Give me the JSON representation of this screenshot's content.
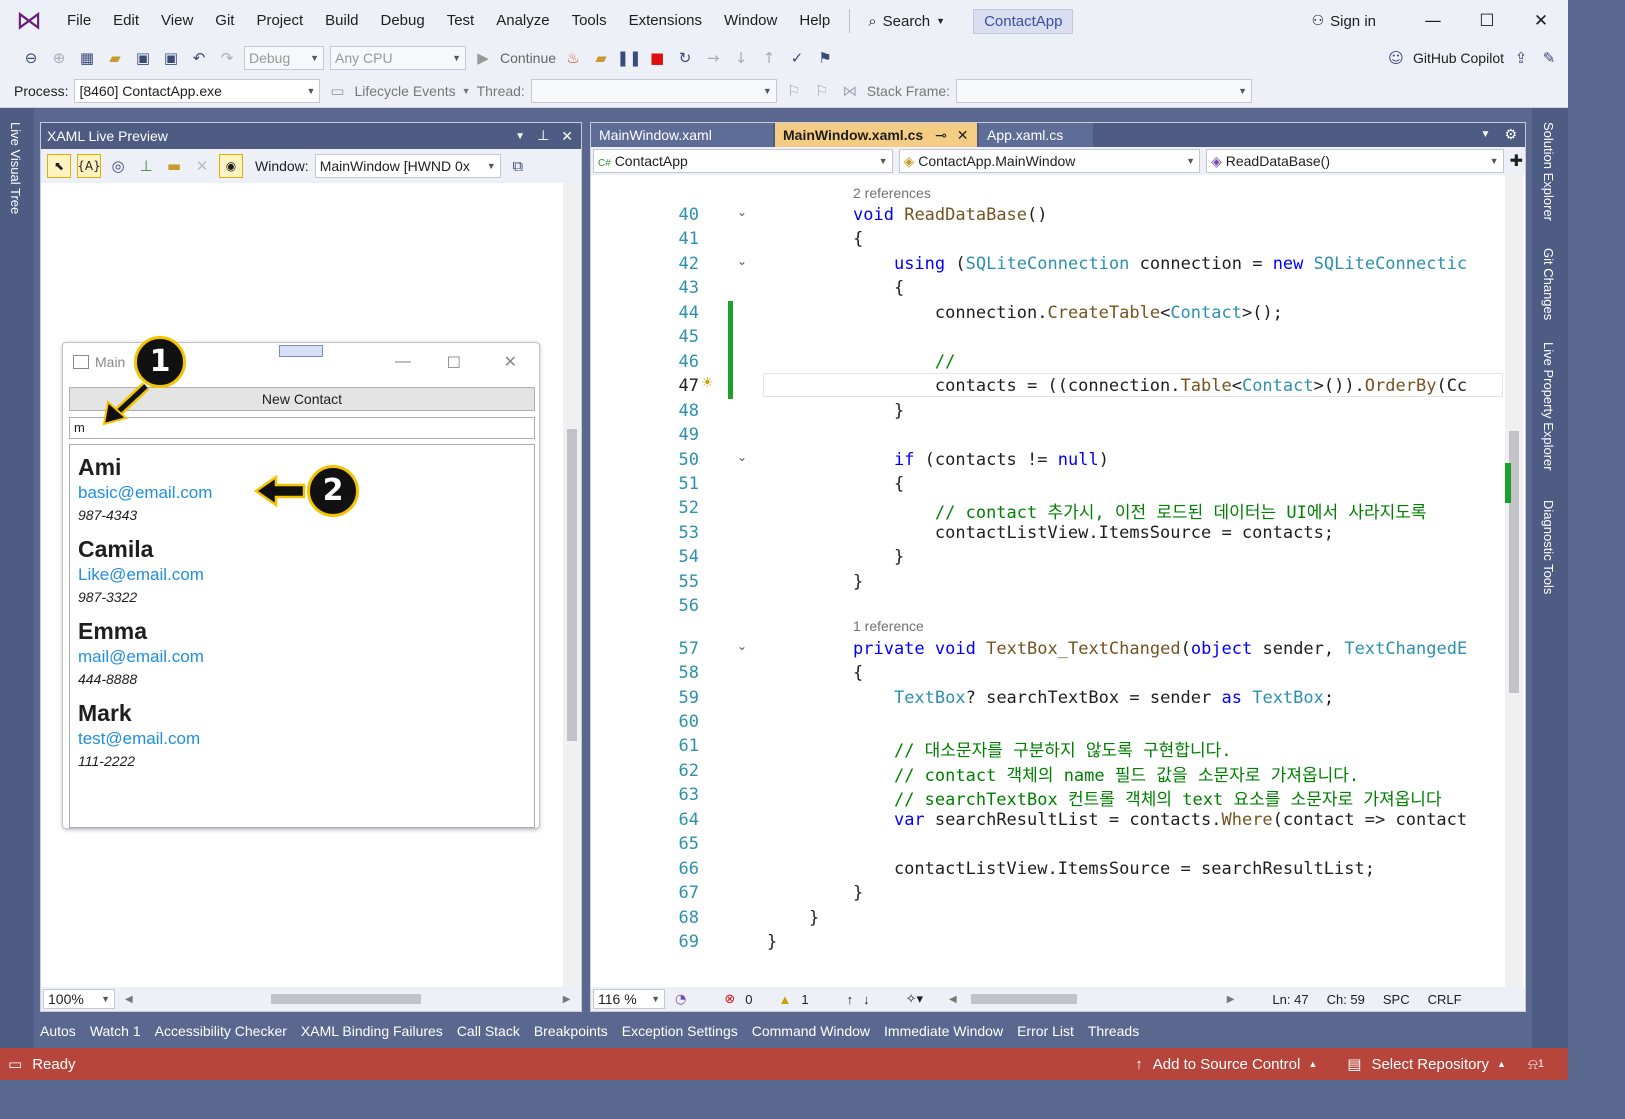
{
  "menubar": {
    "items": [
      "File",
      "Edit",
      "View",
      "Git",
      "Project",
      "Build",
      "Debug",
      "Test",
      "Analyze",
      "Tools",
      "Extensions",
      "Window",
      "Help"
    ],
    "search": "Search",
    "app_name": "ContactApp",
    "sign_in": "Sign in"
  },
  "toolbar": {
    "config": "Debug",
    "platform": "Any CPU",
    "continue": "Continue",
    "copilot": "GitHub Copilot"
  },
  "debugbar": {
    "process_label": "Process:",
    "process_value": "[8460] ContactApp.exe",
    "lifecycle": "Lifecycle Events",
    "thread_label": "Thread:",
    "stackframe_label": "Stack Frame:"
  },
  "side_tabs": {
    "left": "Live Visual Tree",
    "right": [
      "Solution Explorer",
      "Git Changes",
      "Live Property Explorer",
      "Diagnostic Tools"
    ]
  },
  "xaml_preview": {
    "title": "XAML Live Preview",
    "window_label": "Window:",
    "window_value": "MainWindow [HWND 0x",
    "zoom": "100%"
  },
  "mini_window": {
    "title": "Main",
    "new_button": "New Contact",
    "search_text": "m",
    "contacts": [
      {
        "name": "Ami",
        "email": "basic@email.com",
        "phone": "987-4343"
      },
      {
        "name": "Camila",
        "email": "Like@email.com",
        "phone": "987-3322"
      },
      {
        "name": "Emma",
        "email": "mail@email.com",
        "phone": "444-8888"
      },
      {
        "name": "Mark",
        "email": "test@email.com",
        "phone": "111-2222"
      }
    ],
    "callouts": [
      "1",
      "2"
    ]
  },
  "editor": {
    "tabs": [
      "MainWindow.xaml",
      "MainWindow.xaml.cs",
      "App.xaml.cs"
    ],
    "nav": [
      "ContactApp",
      "ContactApp.MainWindow",
      "ReadDataBase()"
    ],
    "refs": [
      "2 references",
      "1 reference"
    ],
    "zoom": "116 %",
    "errors": "0",
    "warnings": "1",
    "ln": "Ln: 47",
    "ch": "Ch: 59",
    "spc": "SPC",
    "crlf": "CRLF",
    "lines": [
      {
        "n": "40",
        "t": "void ReadDataBase()"
      },
      {
        "n": "41",
        "t": "{"
      },
      {
        "n": "42",
        "t": "    using (SQLiteConnection connection = new SQLiteConnectic"
      },
      {
        "n": "43",
        "t": "    {"
      },
      {
        "n": "44",
        "t": "        connection.CreateTable<Contact>();"
      },
      {
        "n": "45",
        "t": ""
      },
      {
        "n": "46",
        "t": "        //"
      },
      {
        "n": "47",
        "t": "        contacts = ((connection.Table<Contact>()).OrderBy(Cc"
      },
      {
        "n": "48",
        "t": "    }"
      },
      {
        "n": "49",
        "t": ""
      },
      {
        "n": "50",
        "t": "    if (contacts != null)"
      },
      {
        "n": "51",
        "t": "    {"
      },
      {
        "n": "52",
        "t": "        // contact 추가시, 이전 로드된 데이터는 UI에서 사라지도록"
      },
      {
        "n": "53",
        "t": "        contactListView.ItemsSource = contacts;"
      },
      {
        "n": "54",
        "t": "    }"
      },
      {
        "n": "55",
        "t": "}"
      },
      {
        "n": "56",
        "t": ""
      },
      {
        "n": "57",
        "t": "private void TextBox_TextChanged(object sender, TextChangedE"
      },
      {
        "n": "58",
        "t": "{"
      },
      {
        "n": "59",
        "t": "    TextBox? searchTextBox = sender as TextBox;"
      },
      {
        "n": "60",
        "t": ""
      },
      {
        "n": "61",
        "t": "    // 대소문자를 구분하지 않도록 구현합니다."
      },
      {
        "n": "62",
        "t": "    // contact 객체의 name 필드 값을 소문자로 가져옵니다."
      },
      {
        "n": "63",
        "t": "    // searchTextBox 컨트롤 객체의 text 요소를 소문자로 가져옵니다"
      },
      {
        "n": "64",
        "t": "    var searchResultList = contacts.Where(contact => contact"
      },
      {
        "n": "65",
        "t": ""
      },
      {
        "n": "66",
        "t": "    contactListView.ItemsSource = searchResultList;"
      },
      {
        "n": "67",
        "t": "}"
      },
      {
        "n": "68",
        "t": "    }"
      },
      {
        "n": "69",
        "t": "}"
      }
    ]
  },
  "bottom_tabs": [
    "Autos",
    "Watch 1",
    "Accessibility Checker",
    "XAML Binding Failures",
    "Call Stack",
    "Breakpoints",
    "Exception Settings",
    "Command Window",
    "Immediate Window",
    "Error List",
    "Threads"
  ],
  "statusbar": {
    "ready": "Ready",
    "source_control": "Add to Source Control",
    "repository": "Select Repository",
    "notifications": "1"
  }
}
